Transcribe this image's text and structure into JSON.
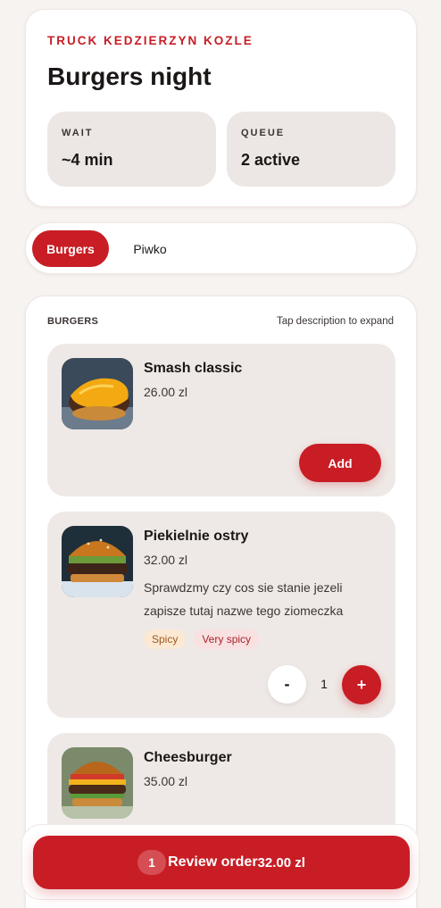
{
  "header": {
    "truck_name": "TRUCK KEDZIERZYN KOZLE",
    "event_title": "Burgers night",
    "wait": {
      "label": "WAIT",
      "value": "~4 min"
    },
    "queue": {
      "label": "QUEUE",
      "value": "2 active"
    }
  },
  "tabs": [
    {
      "label": "Burgers",
      "active": true
    },
    {
      "label": "Piwko",
      "active": false
    }
  ],
  "menu": {
    "section_title": "BURGERS",
    "hint": "Tap description to expand",
    "items": [
      {
        "name": "Smash classic",
        "price": "26.00 zl",
        "action_label": "Add"
      },
      {
        "name": "Piekielnie ostry",
        "price": "32.00 zl",
        "description": "Sprawdzmy czy cos sie stanie jezeli zapisze tutaj nazwe tego ziomeczka",
        "tags": [
          "Spicy",
          "Very spicy"
        ],
        "quantity": "1",
        "minus_label": "-",
        "plus_label": "+"
      },
      {
        "name": "Cheesburger",
        "price": "35.00 zl"
      }
    ]
  },
  "footer": {
    "count": "1",
    "label": "Review order",
    "total": "32.00 zl"
  },
  "colors": {
    "accent": "#c81d25",
    "background": "#f7f3f1",
    "card_muted": "#eee9e6"
  }
}
